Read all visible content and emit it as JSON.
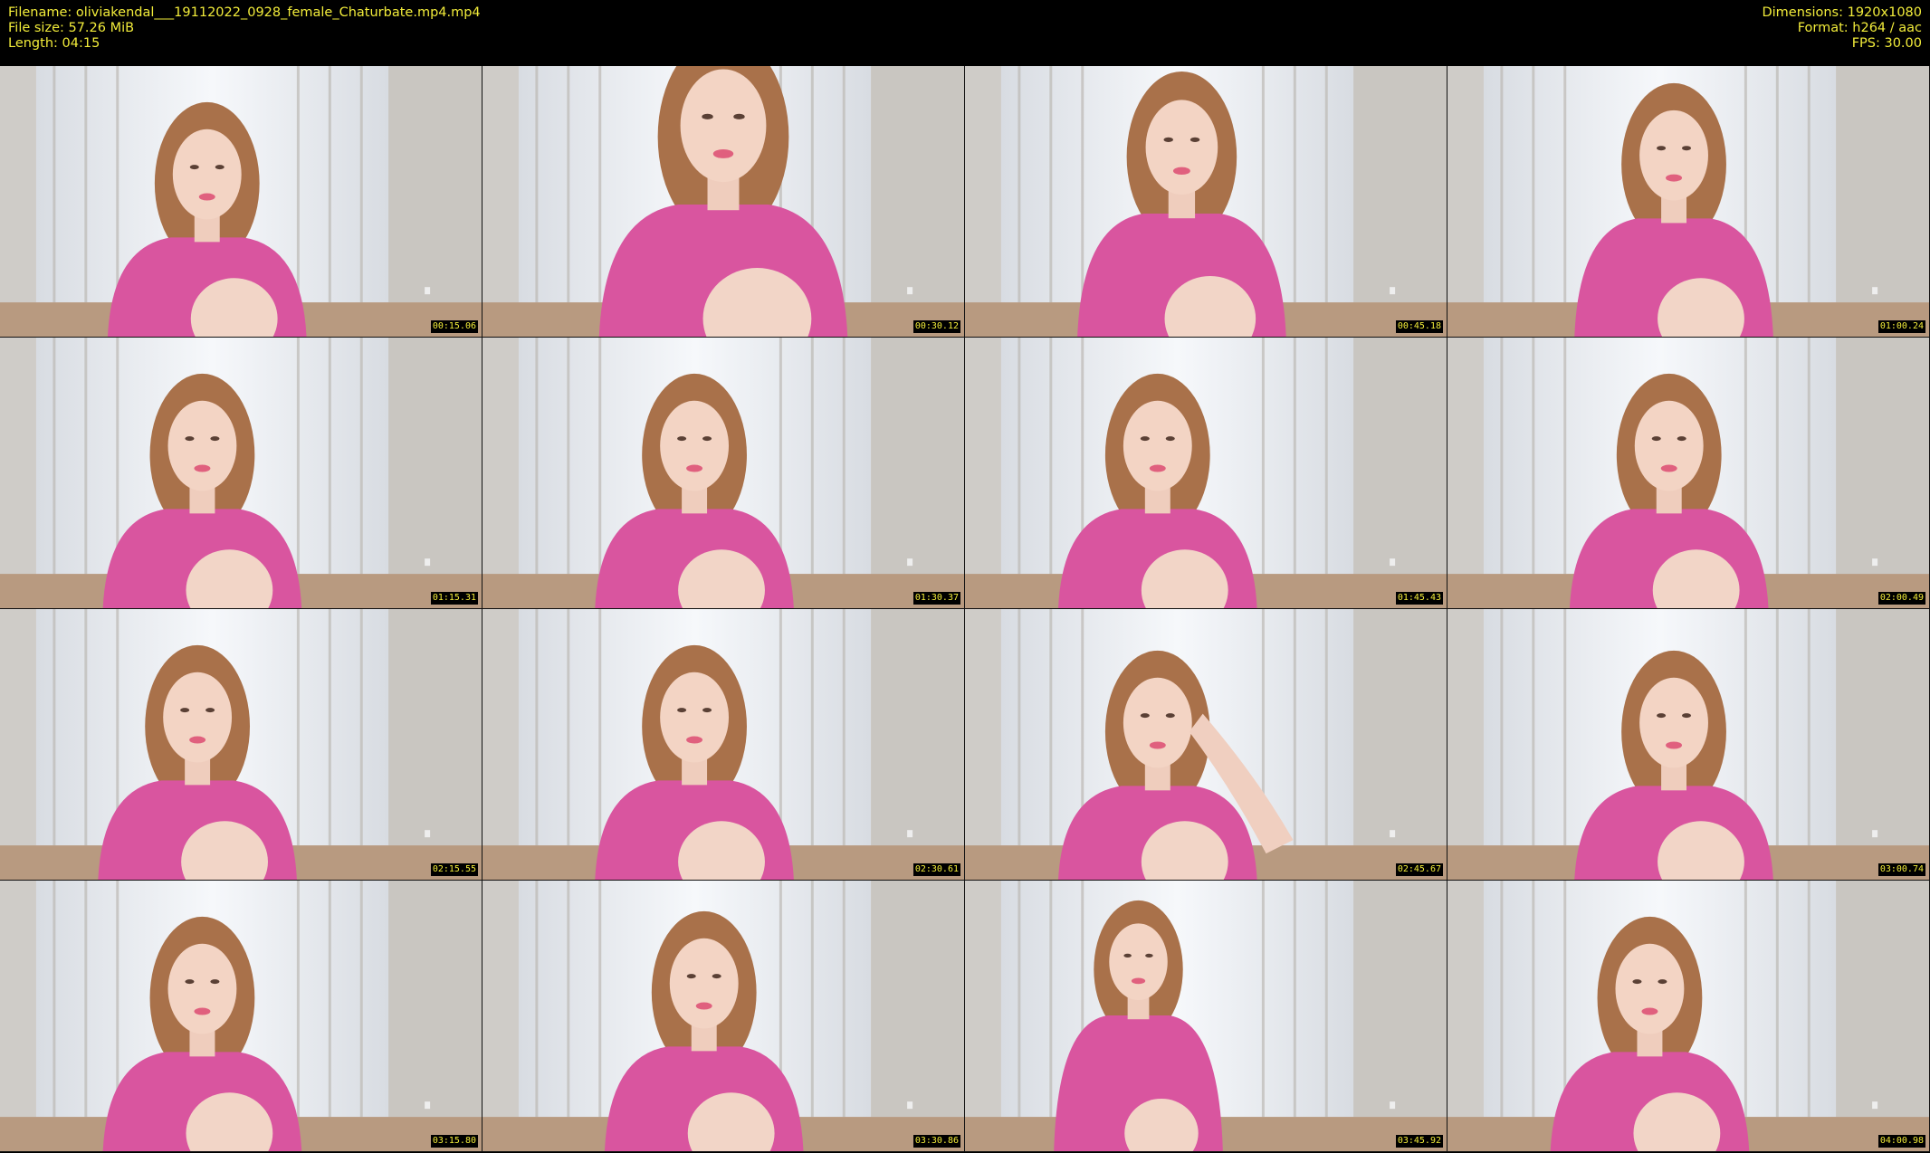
{
  "header": {
    "filename": "Filename: oliviakendal___19112022_0928_female_Chaturbate.mp4.mp4",
    "filesize": "File size: 57.26 MiB",
    "length": "Length: 04:15",
    "dimensions": "Dimensions: 1920x1080",
    "format": "Format: h264 / aac",
    "fps": "FPS: 30.00"
  },
  "colors": {
    "text": "#f2ec3a",
    "background": "#000000",
    "shirt": "#d9559f"
  },
  "thumbnails": [
    {
      "timestamp": "00:15.06"
    },
    {
      "timestamp": "00:30.12"
    },
    {
      "timestamp": "00:45.18"
    },
    {
      "timestamp": "01:00.24"
    },
    {
      "timestamp": "01:15.31"
    },
    {
      "timestamp": "01:30.37"
    },
    {
      "timestamp": "01:45.43"
    },
    {
      "timestamp": "02:00.49"
    },
    {
      "timestamp": "02:15.55"
    },
    {
      "timestamp": "02:30.61"
    },
    {
      "timestamp": "02:45.67"
    },
    {
      "timestamp": "03:00.74"
    },
    {
      "timestamp": "03:15.80"
    },
    {
      "timestamp": "03:30.86"
    },
    {
      "timestamp": "03:45.92"
    },
    {
      "timestamp": "04:00.98"
    }
  ]
}
